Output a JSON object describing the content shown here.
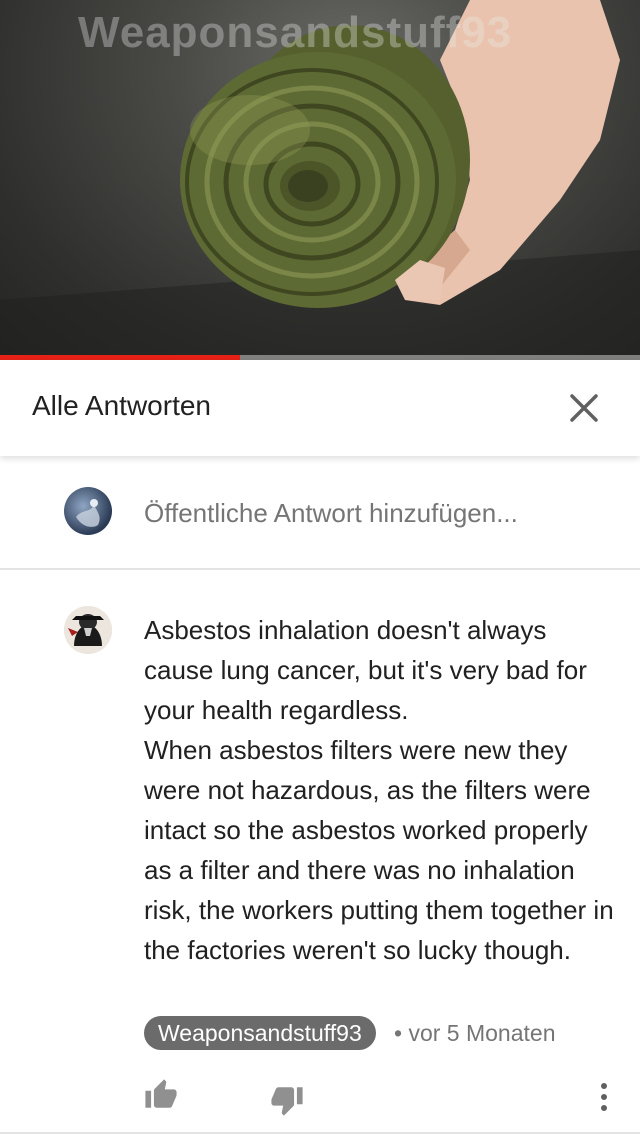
{
  "video": {
    "watermark": "Weaponsandstuff93",
    "progress_fraction": 0.375,
    "accent_color": "#e62117"
  },
  "header": {
    "title": "Alle Antworten",
    "close_icon": "close-icon"
  },
  "reply_box": {
    "placeholder": "Öffentliche Antwort hinzufügen..."
  },
  "comment": {
    "text": "Asbestos inhalation doesn't always cause lung cancer, but it's very bad for your health regardless.\nWhen asbestos filters were new they were not hazardous, as the filters were intact so the asbestos worked properly as a filter and there was no inhalation risk, the workers putting them together in the factories weren't so lucky though.",
    "author": "Weaponsandstuff93",
    "separator": "•",
    "time": "vor 5 Monaten",
    "icons": [
      "thumbs-up-icon",
      "thumbs-down-icon",
      "more-vert-icon"
    ]
  }
}
